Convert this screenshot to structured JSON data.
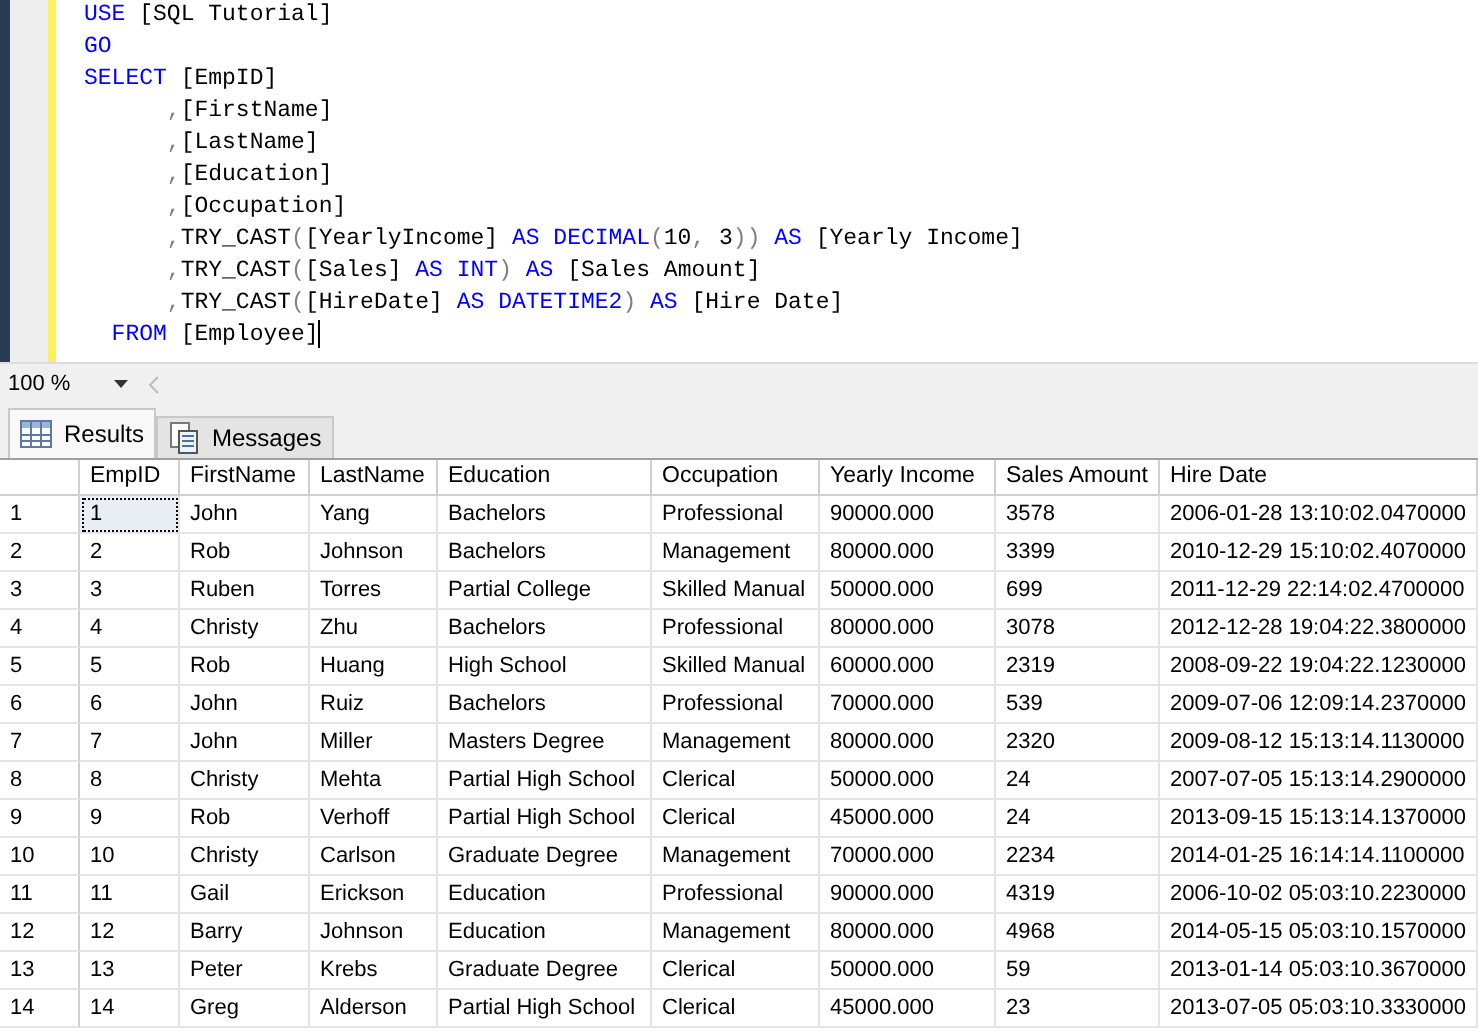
{
  "editor": {
    "lines": [
      [
        {
          "kind": "kw",
          "text": "USE"
        },
        {
          "kind": "id",
          "text": " [SQL Tutorial]"
        }
      ],
      [
        {
          "kind": "kw",
          "text": "GO"
        }
      ],
      [
        {
          "kind": "kw",
          "text": "SELECT"
        },
        {
          "kind": "id",
          "text": " [EmpID]"
        }
      ],
      [
        {
          "kind": "punc",
          "text": "      ,"
        },
        {
          "kind": "id",
          "text": "[FirstName]"
        }
      ],
      [
        {
          "kind": "punc",
          "text": "      ,"
        },
        {
          "kind": "id",
          "text": "[LastName]"
        }
      ],
      [
        {
          "kind": "punc",
          "text": "      ,"
        },
        {
          "kind": "id",
          "text": "[Education]"
        }
      ],
      [
        {
          "kind": "punc",
          "text": "      ,"
        },
        {
          "kind": "id",
          "text": "[Occupation]"
        }
      ],
      [
        {
          "kind": "punc",
          "text": "      ,"
        },
        {
          "kind": "id",
          "text": "TRY_CAST"
        },
        {
          "kind": "punc",
          "text": "("
        },
        {
          "kind": "id",
          "text": "[YearlyIncome] "
        },
        {
          "kind": "kw",
          "text": "AS DECIMAL"
        },
        {
          "kind": "punc",
          "text": "("
        },
        {
          "kind": "id",
          "text": "10"
        },
        {
          "kind": "punc",
          "text": ", "
        },
        {
          "kind": "id",
          "text": "3"
        },
        {
          "kind": "punc",
          "text": ")) "
        },
        {
          "kind": "kw",
          "text": "AS"
        },
        {
          "kind": "id",
          "text": " [Yearly Income]"
        }
      ],
      [
        {
          "kind": "punc",
          "text": "      ,"
        },
        {
          "kind": "id",
          "text": "TRY_CAST"
        },
        {
          "kind": "punc",
          "text": "("
        },
        {
          "kind": "id",
          "text": "[Sales] "
        },
        {
          "kind": "kw",
          "text": "AS INT"
        },
        {
          "kind": "punc",
          "text": ") "
        },
        {
          "kind": "kw",
          "text": "AS"
        },
        {
          "kind": "id",
          "text": " [Sales Amount]"
        }
      ],
      [
        {
          "kind": "punc",
          "text": "      ,"
        },
        {
          "kind": "id",
          "text": "TRY_CAST"
        },
        {
          "kind": "punc",
          "text": "("
        },
        {
          "kind": "id",
          "text": "[HireDate] "
        },
        {
          "kind": "kw",
          "text": "AS DATETIME2"
        },
        {
          "kind": "punc",
          "text": ") "
        },
        {
          "kind": "kw",
          "text": "AS"
        },
        {
          "kind": "id",
          "text": " [Hire Date]"
        }
      ],
      [
        {
          "kind": "kw",
          "text": "  FROM"
        },
        {
          "kind": "id",
          "text": " [Employee]"
        }
      ]
    ]
  },
  "zoom": {
    "value": "100 %"
  },
  "tabs": [
    {
      "label": "Results",
      "kind": "grid",
      "selected": true
    },
    {
      "label": "Messages",
      "kind": "messages",
      "selected": false
    }
  ],
  "grid": {
    "columns": [
      "EmpID",
      "FirstName",
      "LastName",
      "Education",
      "Occupation",
      "Yearly Income",
      "Sales Amount",
      "Hire Date"
    ],
    "rows": [
      {
        "number": "1",
        "focused": true,
        "cells": [
          "1",
          "John",
          "Yang",
          "Bachelors",
          "Professional",
          "90000.000",
          "3578",
          "2006-01-28 13:10:02.0470000"
        ]
      },
      {
        "number": "2",
        "focused": false,
        "cells": [
          "2",
          "Rob",
          "Johnson",
          "Bachelors",
          "Management",
          "80000.000",
          "3399",
          "2010-12-29 15:10:02.4070000"
        ]
      },
      {
        "number": "3",
        "focused": false,
        "cells": [
          "3",
          "Ruben",
          "Torres",
          "Partial College",
          "Skilled Manual",
          "50000.000",
          "699",
          "2011-12-29 22:14:02.4700000"
        ]
      },
      {
        "number": "4",
        "focused": false,
        "cells": [
          "4",
          "Christy",
          "Zhu",
          "Bachelors",
          "Professional",
          "80000.000",
          "3078",
          "2012-12-28 19:04:22.3800000"
        ]
      },
      {
        "number": "5",
        "focused": false,
        "cells": [
          "5",
          "Rob",
          "Huang",
          "High School",
          "Skilled Manual",
          "60000.000",
          "2319",
          "2008-09-22 19:04:22.1230000"
        ]
      },
      {
        "number": "6",
        "focused": false,
        "cells": [
          "6",
          "John",
          "Ruiz",
          "Bachelors",
          "Professional",
          "70000.000",
          "539",
          "2009-07-06 12:09:14.2370000"
        ]
      },
      {
        "number": "7",
        "focused": false,
        "cells": [
          "7",
          "John",
          "Miller",
          "Masters Degree",
          "Management",
          "80000.000",
          "2320",
          "2009-08-12 15:13:14.1130000"
        ]
      },
      {
        "number": "8",
        "focused": false,
        "cells": [
          "8",
          "Christy",
          "Mehta",
          "Partial High School",
          "Clerical",
          "50000.000",
          "24",
          "2007-07-05 15:13:14.2900000"
        ]
      },
      {
        "number": "9",
        "focused": false,
        "cells": [
          "9",
          "Rob",
          "Verhoff",
          "Partial High School",
          "Clerical",
          "45000.000",
          "24",
          "2013-09-15 15:13:14.1370000"
        ]
      },
      {
        "number": "10",
        "focused": false,
        "cells": [
          "10",
          "Christy",
          "Carlson",
          "Graduate Degree",
          "Management",
          "70000.000",
          "2234",
          "2014-01-25 16:14:14.1100000"
        ]
      },
      {
        "number": "11",
        "focused": false,
        "cells": [
          "11",
          "Gail",
          "Erickson",
          "Education",
          "Professional",
          "90000.000",
          "4319",
          "2006-10-02 05:03:10.2230000"
        ]
      },
      {
        "number": "12",
        "focused": false,
        "cells": [
          "12",
          "Barry",
          "Johnson",
          "Education",
          "Management",
          "80000.000",
          "4968",
          "2014-05-15 05:03:10.1570000"
        ]
      },
      {
        "number": "13",
        "focused": false,
        "cells": [
          "13",
          "Peter",
          "Krebs",
          "Graduate Degree",
          "Clerical",
          "50000.000",
          "59",
          "2013-01-14 05:03:10.3670000"
        ]
      },
      {
        "number": "14",
        "focused": false,
        "cells": [
          "14",
          "Greg",
          "Alderson",
          "Partial High School",
          "Clerical",
          "45000.000",
          "23",
          "2013-07-05 05:03:10.3330000"
        ]
      }
    ]
  }
}
